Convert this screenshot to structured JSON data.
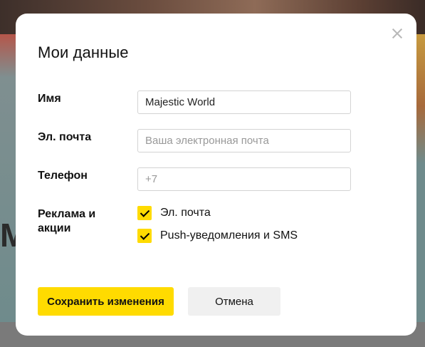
{
  "dialog": {
    "title": "Мои данные",
    "close_icon": "close-icon"
  },
  "form": {
    "name": {
      "label": "Имя",
      "value": "Majestic World",
      "placeholder": ""
    },
    "email": {
      "label": "Эл. почта",
      "value": "",
      "placeholder": "Ваша электронная почта"
    },
    "phone": {
      "label": "Телефон",
      "value": "",
      "placeholder": "+7"
    },
    "ads": {
      "label_line1": "Реклама и",
      "label_line2": "акции",
      "options": [
        {
          "label": "Эл. почта",
          "checked": true
        },
        {
          "label": "Push-уведомления и SMS",
          "checked": true
        }
      ]
    }
  },
  "actions": {
    "save_label": "Сохранить изменения",
    "cancel_label": "Отмена"
  },
  "background": {
    "partial_letter": "M"
  },
  "colors": {
    "accent": "#ffdb00",
    "secondary_button": "#f0f0f0",
    "field_border": "#d3d3d3"
  }
}
